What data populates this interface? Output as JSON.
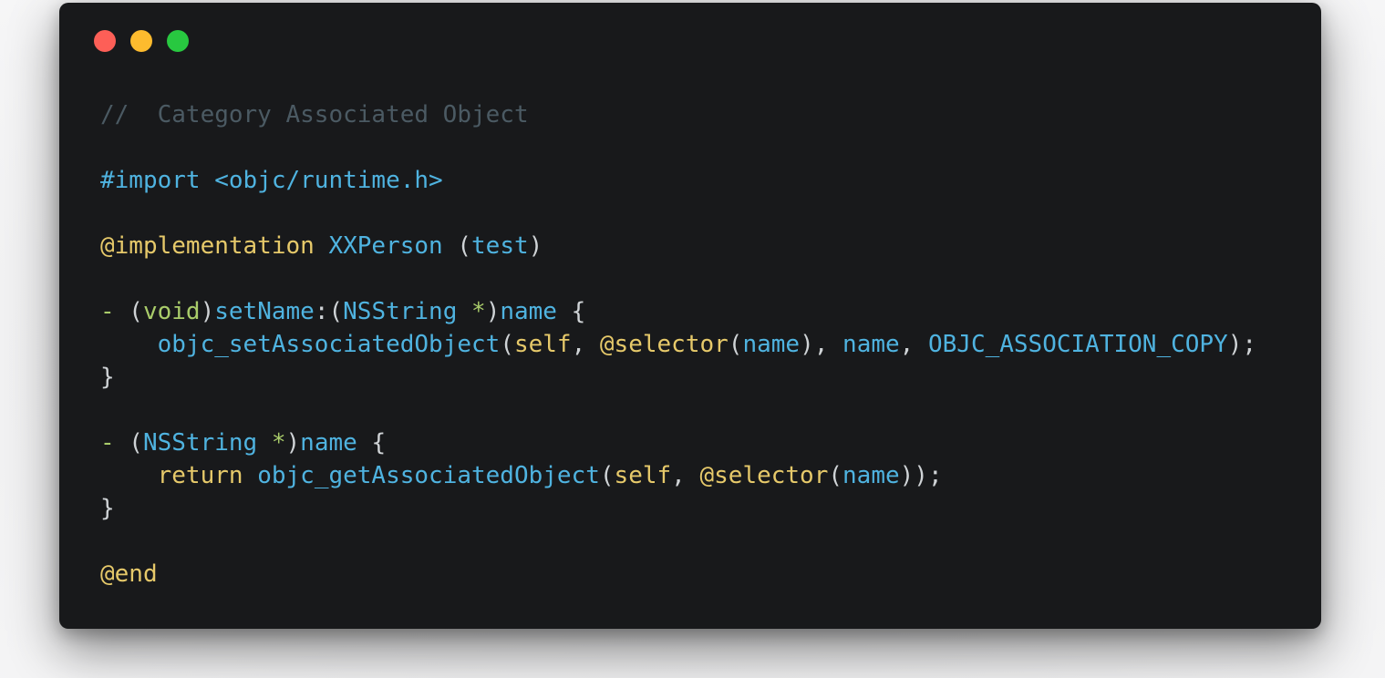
{
  "colors": {
    "window_bg": "#18191b",
    "close": "#fd5f57",
    "minimize": "#fdbb2e",
    "zoom": "#28c840",
    "comment": "#4b5a63",
    "blue": "#4fb3e0",
    "yellow": "#e6c96a",
    "green": "#a9cc6a",
    "plain": "#cfd3d6"
  },
  "window_controls": [
    "close",
    "minimize",
    "zoom"
  ],
  "code_lines": [
    [
      {
        "text": "//  Category Associated Object",
        "kind": "comment"
      }
    ],
    [],
    [
      {
        "text": "#import <objc/runtime.h>",
        "kind": "directive"
      }
    ],
    [],
    [
      {
        "text": "@implementation",
        "kind": "keyword"
      },
      {
        "text": " ",
        "kind": "plain"
      },
      {
        "text": "XXPerson",
        "kind": "class"
      },
      {
        "text": " (",
        "kind": "plain"
      },
      {
        "text": "test",
        "kind": "class"
      },
      {
        "text": ")",
        "kind": "plain"
      }
    ],
    [],
    [
      {
        "text": "-",
        "kind": "op"
      },
      {
        "text": " (",
        "kind": "plain"
      },
      {
        "text": "void",
        "kind": "type"
      },
      {
        "text": ")",
        "kind": "plain"
      },
      {
        "text": "setName",
        "kind": "method"
      },
      {
        "text": ":(",
        "kind": "plain"
      },
      {
        "text": "NSString",
        "kind": "class"
      },
      {
        "text": " ",
        "kind": "plain"
      },
      {
        "text": "*",
        "kind": "op"
      },
      {
        "text": ")",
        "kind": "plain"
      },
      {
        "text": "name",
        "kind": "method"
      },
      {
        "text": " {",
        "kind": "plain"
      }
    ],
    [
      {
        "text": "    ",
        "kind": "plain"
      },
      {
        "text": "objc_setAssociatedObject",
        "kind": "method"
      },
      {
        "text": "(",
        "kind": "plain"
      },
      {
        "text": "self",
        "kind": "self"
      },
      {
        "text": ", ",
        "kind": "plain"
      },
      {
        "text": "@selector",
        "kind": "keyword"
      },
      {
        "text": "(",
        "kind": "plain"
      },
      {
        "text": "name",
        "kind": "method"
      },
      {
        "text": "), ",
        "kind": "plain"
      },
      {
        "text": "name",
        "kind": "method"
      },
      {
        "text": ", ",
        "kind": "plain"
      },
      {
        "text": "OBJC_ASSOCIATION_COPY",
        "kind": "const"
      },
      {
        "text": ");",
        "kind": "plain"
      }
    ],
    [
      {
        "text": "}",
        "kind": "plain"
      }
    ],
    [],
    [
      {
        "text": "-",
        "kind": "op"
      },
      {
        "text": " (",
        "kind": "plain"
      },
      {
        "text": "NSString",
        "kind": "class"
      },
      {
        "text": " ",
        "kind": "plain"
      },
      {
        "text": "*",
        "kind": "op"
      },
      {
        "text": ")",
        "kind": "plain"
      },
      {
        "text": "name",
        "kind": "method"
      },
      {
        "text": " {",
        "kind": "plain"
      }
    ],
    [
      {
        "text": "    ",
        "kind": "plain"
      },
      {
        "text": "return",
        "kind": "keyword"
      },
      {
        "text": " ",
        "kind": "plain"
      },
      {
        "text": "objc_getAssociatedObject",
        "kind": "method"
      },
      {
        "text": "(",
        "kind": "plain"
      },
      {
        "text": "self",
        "kind": "self"
      },
      {
        "text": ", ",
        "kind": "plain"
      },
      {
        "text": "@selector",
        "kind": "keyword"
      },
      {
        "text": "(",
        "kind": "plain"
      },
      {
        "text": "name",
        "kind": "method"
      },
      {
        "text": "));",
        "kind": "plain"
      }
    ],
    [
      {
        "text": "}",
        "kind": "plain"
      }
    ],
    [],
    [
      {
        "text": "@end",
        "kind": "keyword"
      }
    ]
  ]
}
